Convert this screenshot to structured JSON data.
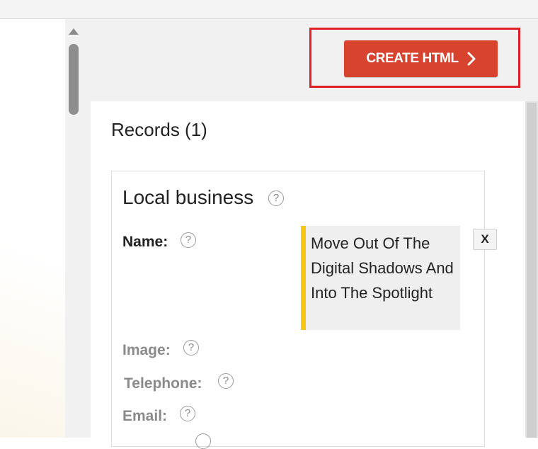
{
  "toolbar": {
    "create_button_label": "CREATE HTML",
    "create_button_icon": "chevron-right-icon",
    "accent_color": "#d8432f",
    "highlight_color": "#e01f26"
  },
  "records": {
    "title": "Records (1)"
  },
  "card": {
    "title": "Local business",
    "help_glyph": "?",
    "fields": {
      "name": {
        "label": "Name:",
        "value": "Move Out Of The Digital Shadows And Into The Spotlight"
      },
      "image": {
        "label": "Image:"
      },
      "telephone": {
        "label": "Telephone:"
      },
      "email": {
        "label": "Email:"
      }
    },
    "remove_label": "X",
    "value_marker_color": "#f5c518"
  }
}
